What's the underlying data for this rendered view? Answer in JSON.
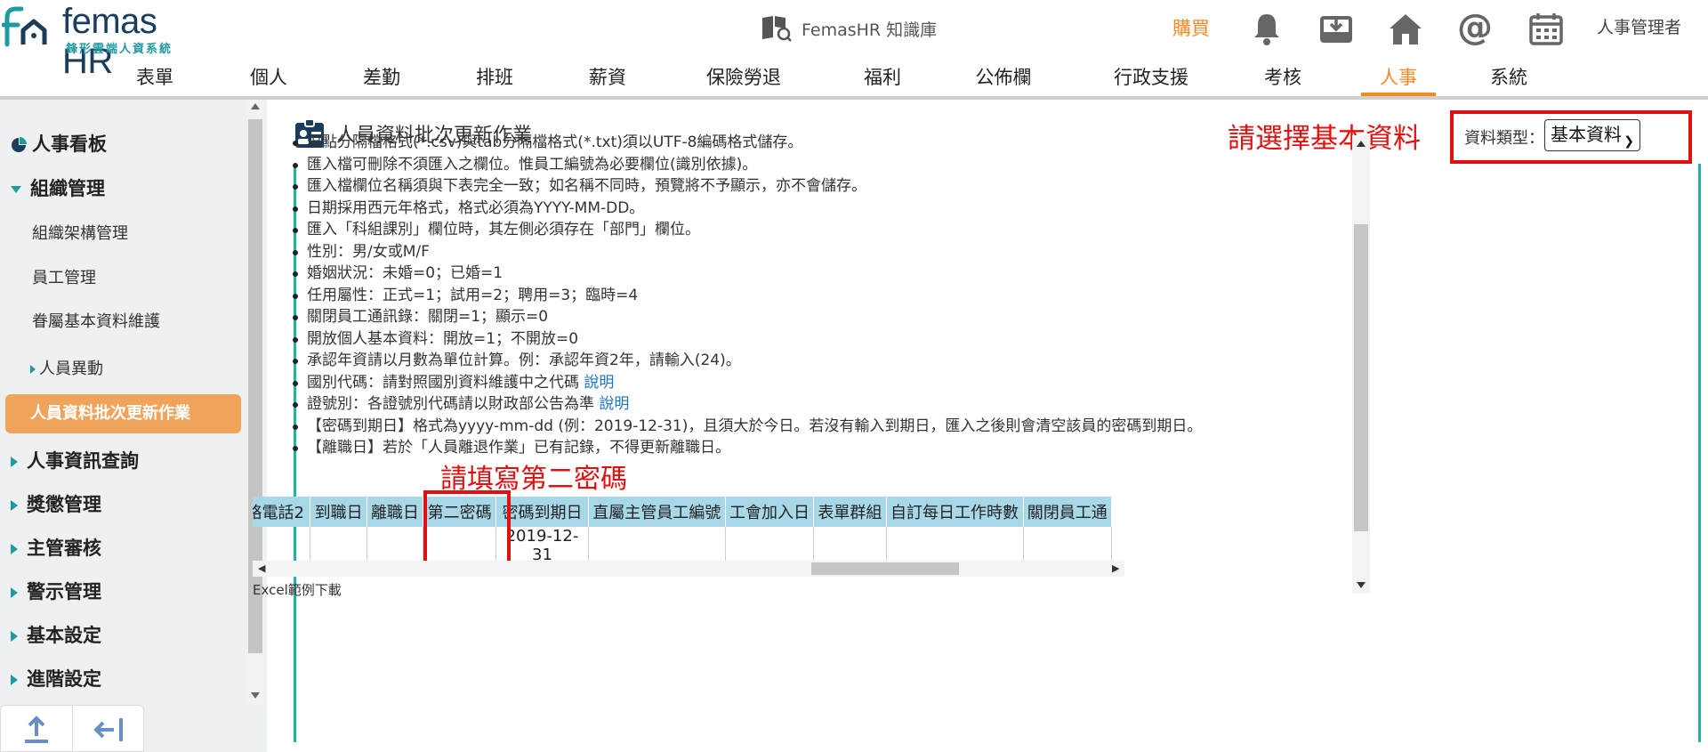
{
  "header": {
    "logo_text": "femas HR",
    "logo_sub": "鋒形雲端人資系統",
    "kb_label": "FemasHR 知識庫",
    "buy_label": "購買",
    "user_label": "人事管理者"
  },
  "nav": [
    "表單",
    "個人",
    "差勤",
    "排班",
    "薪資",
    "保險勞退",
    "福利",
    "公佈欄",
    "行政支援",
    "考核",
    "人事",
    "系統"
  ],
  "nav_active": "人事",
  "sidebar": {
    "dashboard": "人事看板",
    "org_mgmt": "組織管理",
    "org_chart": "組織架構管理",
    "employee_mgmt": "員工管理",
    "family_basic": "眷屬基本資料維護",
    "transfer": "人員異動",
    "batch_update": "人員資料批次更新作業",
    "hr_query": "人事資訊查詢",
    "reward": "獎懲管理",
    "supervisor": "主管審核",
    "alert": "警示管理",
    "basic_settings": "基本設定",
    "advanced_settings": "進階設定"
  },
  "page": {
    "title": "人員資料批次更新作業",
    "hint_select": "請選擇基本資料",
    "type_label": "資料類型：",
    "type_value": "基本資料",
    "hint_password": "請填寫第二密碼",
    "excel_link": "Excel範例下載"
  },
  "notes": {
    "n1": "逗點分隔檔格式(*.csv)與tab分隔檔格式(*.txt)須以UTF-8編碼格式儲存。",
    "n2": "匯入檔可刪除不須匯入之欄位。惟員工編號為必要欄位(識別依據)。",
    "n3": "匯入檔欄位名稱須與下表完全一致；如名稱不同時，預覽將不予顯示，亦不會儲存。",
    "n4": "日期採用西元年格式，格式必須為YYYY-MM-DD。",
    "n5": "匯入「科組課別」欄位時，其左側必須存在「部門」欄位。",
    "n6": "性別：男/女或M/F",
    "n7": "婚姻狀況：未婚=0；已婚=1",
    "n8": "任用屬性：正式=1；試用=2；聘用=3；臨時=4",
    "n9": "關閉員工通訊錄：關閉=1；顯示=0",
    "n10": "開放個人基本資料：開放=1；不開放=0",
    "n11": "承認年資請以月數為單位計算。例：承認年資2年，請輸入(24)。",
    "n12": "國別代碼：請對照國別資料維護中之代碼 ",
    "n12_link": "說明",
    "n13": "證號別：各證號別代碼請以財政部公告為準 ",
    "n13_link": "說明",
    "n14": "【密碼到期日】格式為yyyy-mm-dd (例：2019-12-31)，且須大於今日。若沒有輸入到期日，匯入之後則會清空該員的密碼到期日。",
    "n15": "【離職日】若於「人員離退作業」已有記錄，不得更新離職日。"
  },
  "table": {
    "headers": [
      "絡電話2",
      "到職日",
      "離職日",
      "第二密碼",
      "密碼到期日",
      "直屬主管員工編號",
      "工會加入日",
      "表單群組",
      "自訂每日工作時數",
      "關閉員工通"
    ],
    "row": [
      "",
      "",
      "",
      "",
      "2019-12-31",
      "",
      "",
      "",
      "",
      ""
    ]
  },
  "colors": {
    "accent": "#f08a24",
    "teal": "#1eb4a6",
    "red": "#e01010",
    "header_cell": "#a8d8e8"
  }
}
